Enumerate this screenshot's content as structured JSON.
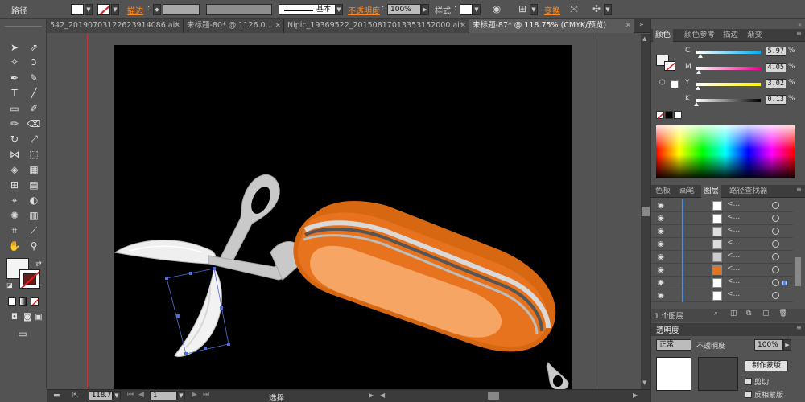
{
  "control_bar": {
    "object_type": "路径",
    "stroke_label": "描边",
    "stroke_profile": "基本",
    "opacity_label": "不透明度",
    "opacity_value": "100%",
    "style_label": "样式",
    "transform_label": "变换"
  },
  "tabs": [
    {
      "label": "542_20190703122623914086.ai*",
      "active": false
    },
    {
      "label": "未标题-80* @ 1126.0...",
      "active": false
    },
    {
      "label": "Nipic_19369522_20150817013353152000.ai*",
      "active": false
    },
    {
      "label": "未标题-87* @ 118.75% (CMYK/预览)",
      "active": true
    }
  ],
  "status_bar": {
    "zoom": "118.75",
    "page": "1",
    "tool": "选择"
  },
  "color_panel": {
    "tabs": [
      "颜色",
      "颜色参考",
      "描边",
      "渐变"
    ],
    "sliders": [
      {
        "label": "C",
        "value": "5.97",
        "pct": 0.06
      },
      {
        "label": "M",
        "value": "4.05",
        "pct": 0.04
      },
      {
        "label": "Y",
        "value": "3.02",
        "pct": 0.03
      },
      {
        "label": "K",
        "value": "0.13",
        "pct": 0.0
      }
    ]
  },
  "layers_panel": {
    "tabs": [
      "色板",
      "画笔",
      "图层",
      "路径查找器"
    ],
    "row_name": "<...",
    "row_count": 8,
    "footer": "1 个图层"
  },
  "transparency_panel": {
    "title": "透明度",
    "mode": "正常",
    "opacity_label": "不透明度",
    "opacity_value": "100%",
    "make_mask_button": "制作蒙版",
    "clip_label": "剪切",
    "invert_mask_label": "反相蒙版"
  },
  "colors": {
    "ui_bg": "#535353",
    "artboard": "#000000",
    "knife_orange": "#e8731f",
    "knife_light": "#f6a564",
    "accent_orange": "#ff8a1f",
    "selection_blue": "#4d8fe8"
  }
}
